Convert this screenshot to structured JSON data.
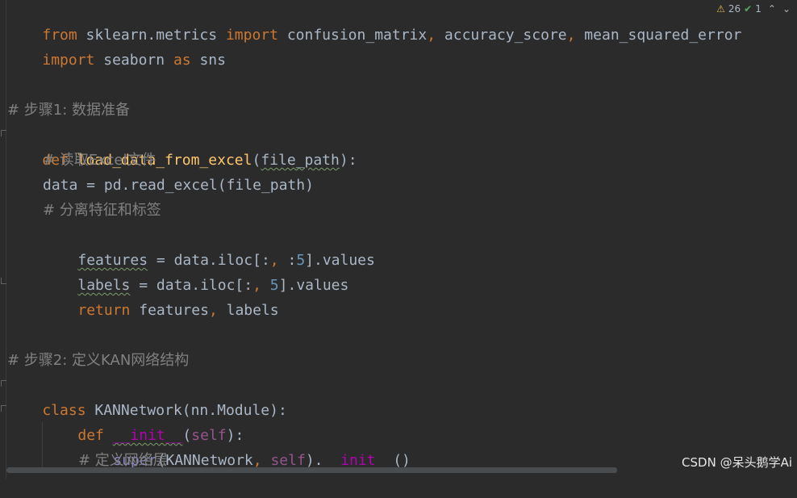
{
  "code_lines": {
    "l1": {
      "t1": "from",
      "t2": " sklearn.metrics ",
      "t3": "import",
      "t4": " confusion_matrix",
      "t5": ",",
      "t6": " accuracy_score",
      "t7": ",",
      "t8": " mean_squared_error"
    },
    "l2": {
      "t1": "import",
      "t2": " seaborn ",
      "t3": "as",
      "t4": " sns"
    },
    "l3": {
      "comment": "# 步骤1: 数据准备"
    },
    "l4": {
      "t1": "def",
      "t2": " ",
      "t3": "load_data_from_excel",
      "t4": "(",
      "t5": "file_path",
      "t6": "):"
    },
    "l5": {
      "comment": "# 读取Excel文件"
    },
    "l6": {
      "text": "data = pd.read_excel(file_path)"
    },
    "l7": {
      "comment": "# 分离特征和标签"
    },
    "l8": {
      "t1": "features",
      "t2": " = data.iloc[:",
      "t3": ",",
      "t4": " :",
      "t5": "5",
      "t6": "].values"
    },
    "l9": {
      "t1": "labels",
      "t2": " = data.iloc[:",
      "t3": ",",
      "t4": " ",
      "t5": "5",
      "t6": "].values"
    },
    "l10": {
      "t1": "return",
      "t2": " features",
      "t3": ",",
      "t4": " labels"
    },
    "l11": {
      "comment": "# 步骤2: 定义KAN网络结构"
    },
    "l12": {
      "t1": "class",
      "t2": " KANNetwork(nn.Module):"
    },
    "l13": {
      "t1": "def",
      "t2": " ",
      "t3": "__init__",
      "t4": "(",
      "t5": "self",
      "t6": "):"
    },
    "l14": {
      "t1": "super",
      "t2": "(KANNetwork",
      "t3": ",",
      "t4": " ",
      "t5": "self",
      "t6": ").",
      "t7": "__init__",
      "t8": "()"
    },
    "l15": {
      "comment": "# 定义网络层"
    }
  },
  "inspections": {
    "warnings_count": "26",
    "ok_count": "1"
  },
  "watermark": "CSDN @呆头鹅学Ai",
  "colors": {
    "background": "#2b2b2b",
    "keyword": "#cc7832",
    "function": "#ffc66d",
    "comment": "#808080",
    "number": "#6897bb",
    "magic": "#b200b2",
    "self": "#94558d",
    "default": "#a9b7c6"
  }
}
